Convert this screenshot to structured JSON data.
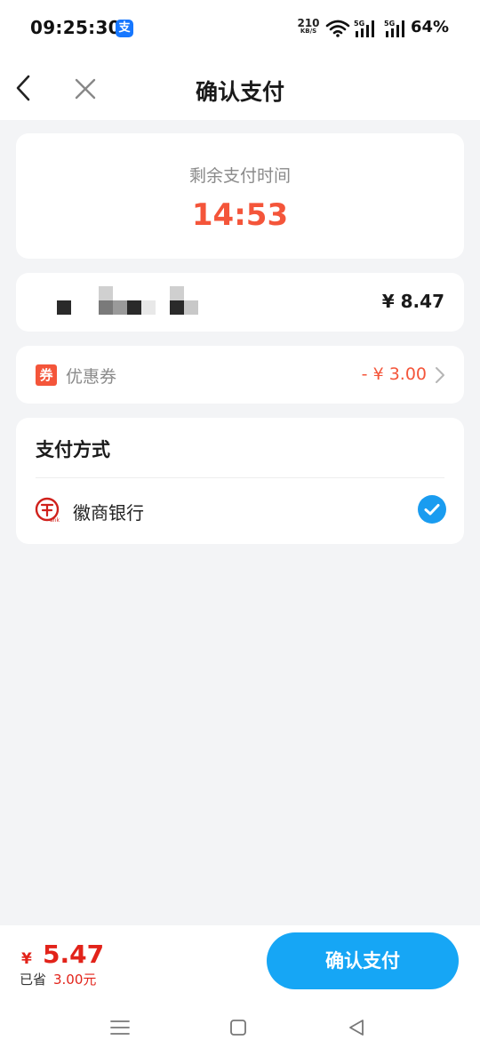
{
  "status_bar": {
    "time": "09:25:30",
    "app_icon_glyph": "支",
    "net_speed_value": "210",
    "net_speed_unit": "KB/S",
    "signal1_label": "5G",
    "signal2_label": "5G",
    "battery": "64%"
  },
  "header": {
    "title": "确认支付"
  },
  "timer": {
    "label": "剩余支付时间",
    "value": "14:53"
  },
  "merchant": {
    "amount": "¥ 8.47"
  },
  "coupon": {
    "icon_glyph": "券",
    "label": "优惠券",
    "discount": "- ¥ 3.00"
  },
  "payment": {
    "title": "支付方式",
    "bank_name": "徽商银行",
    "bank_selected": true
  },
  "bottom": {
    "currency": "¥",
    "total": "5.47",
    "saved_label": "已省",
    "saved_value": "3.00元",
    "confirm_label": "确认支付"
  },
  "colors": {
    "accent_red": "#f4553a",
    "price_red": "#e2231a",
    "primary_blue": "#16a6f5",
    "background": "#f3f4f6"
  },
  "icons": [
    "back-arrow-icon",
    "close-icon",
    "wifi-icon",
    "signal-icon",
    "chevron-right-icon",
    "checkmark-icon",
    "bank-logo-icon",
    "menu-icon",
    "home-icon",
    "back-triangle-icon"
  ]
}
